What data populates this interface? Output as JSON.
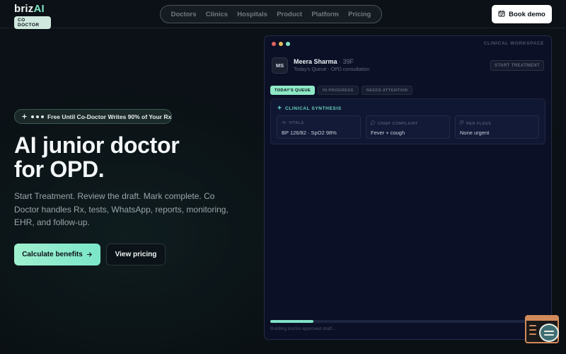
{
  "brand": {
    "name_prefix": "briz",
    "name_suffix": "AI",
    "badge": "CO DOCTOR"
  },
  "nav": {
    "items": [
      "Doctors",
      "Clinics",
      "Hospitals",
      "Product",
      "Platform",
      "Pricing"
    ]
  },
  "header": {
    "book_demo_label": "Book demo"
  },
  "hero": {
    "promo": "Free Until Co-Doctor Writes 90% of Your Rx",
    "title_line1": "AI junior doctor",
    "title_line2": "for OPD.",
    "description": "Start Treatment. Review the draft. Mark complete. Co Doctor handles Rx, tests, WhatsApp, reports, monitoring, EHR, and follow-up.",
    "cta_primary": "Calculate benefits",
    "cta_secondary": "View pricing"
  },
  "workspace": {
    "label": "CLINICAL WORKSPACE",
    "window_dots": [
      "#e0625a",
      "#e5b95a",
      "#7fe3c6"
    ],
    "patient": {
      "initials": "MS",
      "name": "Meera Sharma",
      "separator": " · ",
      "age": "39F",
      "subtitle": "Today's Queue · OPD consultation"
    },
    "start_button": "START TREATMENT",
    "tabs": [
      {
        "label": "TODAY'S QUEUE",
        "active": true
      },
      {
        "label": "IN PROGRESS",
        "active": false
      },
      {
        "label": "NEEDS ATTENTION",
        "active": false
      }
    ],
    "synthesis": {
      "title": "CLINICAL SYNTHESIS",
      "cards": [
        {
          "label": "VITALS",
          "icon": "pulse-icon",
          "value": "BP 126/82 · SpO2 98%"
        },
        {
          "label": "CHIEF COMPLAINT",
          "icon": "chat-bubble-icon",
          "value": "Fever + cough"
        },
        {
          "label": "RED FLAGS",
          "icon": "flag-icon",
          "value": "None urgent"
        }
      ]
    },
    "progress": {
      "fraction": 0.155,
      "text": "Building doctor-approved draft..."
    }
  },
  "colors": {
    "accent": "#7fe3c6",
    "panel_bg": "#0b1026",
    "page_bg": "#0a1014"
  }
}
